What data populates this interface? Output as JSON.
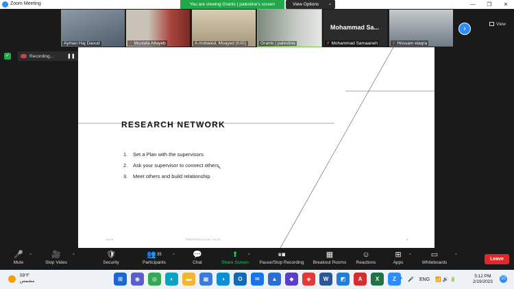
{
  "window": {
    "title": "Zoom Meeting",
    "controls": [
      "—",
      "❐",
      "✕"
    ]
  },
  "banner": {
    "text": "You are viewing Grants | palestine's screen",
    "view_options": "View Options",
    "chevron": "⌄"
  },
  "gallery": {
    "participants": [
      {
        "name": "Ayman Haj Daoud",
        "muted": false,
        "bg": "#6b7b8c"
      },
      {
        "name": "Mustafa Altayeb",
        "muted": true,
        "bg": "#8a5a4a"
      },
      {
        "name": "A.mobaied, Moayed (IUG)",
        "muted": false,
        "bg": "#b8a98f"
      },
      {
        "name": "Grants | palestine",
        "muted": false,
        "bg": "#9aa39a"
      },
      {
        "name": "Mohammad Samaaneh",
        "muted": true,
        "bg": "#2b2b2b",
        "big_name": "Mohammad Sa..."
      },
      {
        "name": "Hossam elaqra",
        "muted": true,
        "bg": "#7a8a9a"
      }
    ],
    "next_arrow": "›",
    "view_label": "View"
  },
  "recording": {
    "shield": "✓",
    "label": "Recording...",
    "pause_symbol": "❚❚"
  },
  "slide": {
    "title": "RESEARCH NETWORK",
    "items": [
      {
        "num": "1.",
        "text": "Set a Plan with the supervisors"
      },
      {
        "num": "2.",
        "text": "Ask your supervisor to connect others"
      },
      {
        "num": "3.",
        "text": "Meet others and build relationship"
      }
    ],
    "footer_left": "20XX",
    "footer_center": "PRESENTATION TITLE",
    "footer_right": "8"
  },
  "toolbar": {
    "mute": {
      "icon": "🎤",
      "label": "Mute"
    },
    "video": {
      "icon": "🎥",
      "label": "Stop Video"
    },
    "security": {
      "icon": "🛡",
      "label": "Security"
    },
    "participants": {
      "icon": "👥",
      "label": "Participants",
      "count": "35"
    },
    "chat": {
      "icon": "💬",
      "label": "Chat"
    },
    "share": {
      "icon": "⬆",
      "label": "Share Screen"
    },
    "record": {
      "icon": "⏸⏹",
      "label": "Pause/Stop Recording"
    },
    "breakout": {
      "icon": "▦",
      "label": "Breakout Rooms"
    },
    "reactions": {
      "icon": "☺",
      "label": "Reactions"
    },
    "apps": {
      "icon": "⊞",
      "label": "Apps"
    },
    "whiteboards": {
      "icon": "▭",
      "label": "Whiteboards"
    },
    "leave": "Leave",
    "caret": "^"
  },
  "taskbar": {
    "weather_temp": "59°F",
    "weather_desc": "مشمس",
    "apps": [
      {
        "name": "start-icon",
        "glyph": "⊞",
        "color": "#1e66d0"
      },
      {
        "name": "teams-icon",
        "glyph": "◉",
        "color": "#5b5fc7"
      },
      {
        "name": "chrome-icon",
        "glyph": "◎",
        "color": "#34a853"
      },
      {
        "name": "edge-beta-icon",
        "glyph": "◐",
        "color": "#0aa3c4"
      },
      {
        "name": "folder-icon",
        "glyph": "▬",
        "color": "#f2b632"
      },
      {
        "name": "calendar-icon",
        "glyph": "▦",
        "color": "#3b7be0"
      },
      {
        "name": "edge-icon",
        "glyph": "◑",
        "color": "#0b8fd6"
      },
      {
        "name": "outlook-icon",
        "glyph": "O",
        "color": "#0f6cbd"
      },
      {
        "name": "mail-icon",
        "glyph": "✉",
        "color": "#1a73e8"
      },
      {
        "name": "photos-icon",
        "glyph": "▲",
        "color": "#2a6fd6"
      },
      {
        "name": "onenote-icon",
        "glyph": "◆",
        "color": "#5b3fc7"
      },
      {
        "name": "anydesk-icon",
        "glyph": "◈",
        "color": "#e53935"
      },
      {
        "name": "word-icon",
        "glyph": "W",
        "color": "#2b579a"
      },
      {
        "name": "photo-editor-icon",
        "glyph": "◩",
        "color": "#1f7fd6"
      },
      {
        "name": "acrobat-icon",
        "glyph": "A",
        "color": "#d32f2f"
      },
      {
        "name": "excel-icon",
        "glyph": "X",
        "color": "#217346"
      },
      {
        "name": "zoom-icon",
        "glyph": "Z",
        "color": "#2d8cff"
      }
    ],
    "tray_chevron": "^",
    "mic": "🎤",
    "lang": "ENG",
    "tray_icons": "📶 🔊 🔋",
    "time": "5:12 PM",
    "date": "2/19/2023",
    "notifications": "10"
  }
}
